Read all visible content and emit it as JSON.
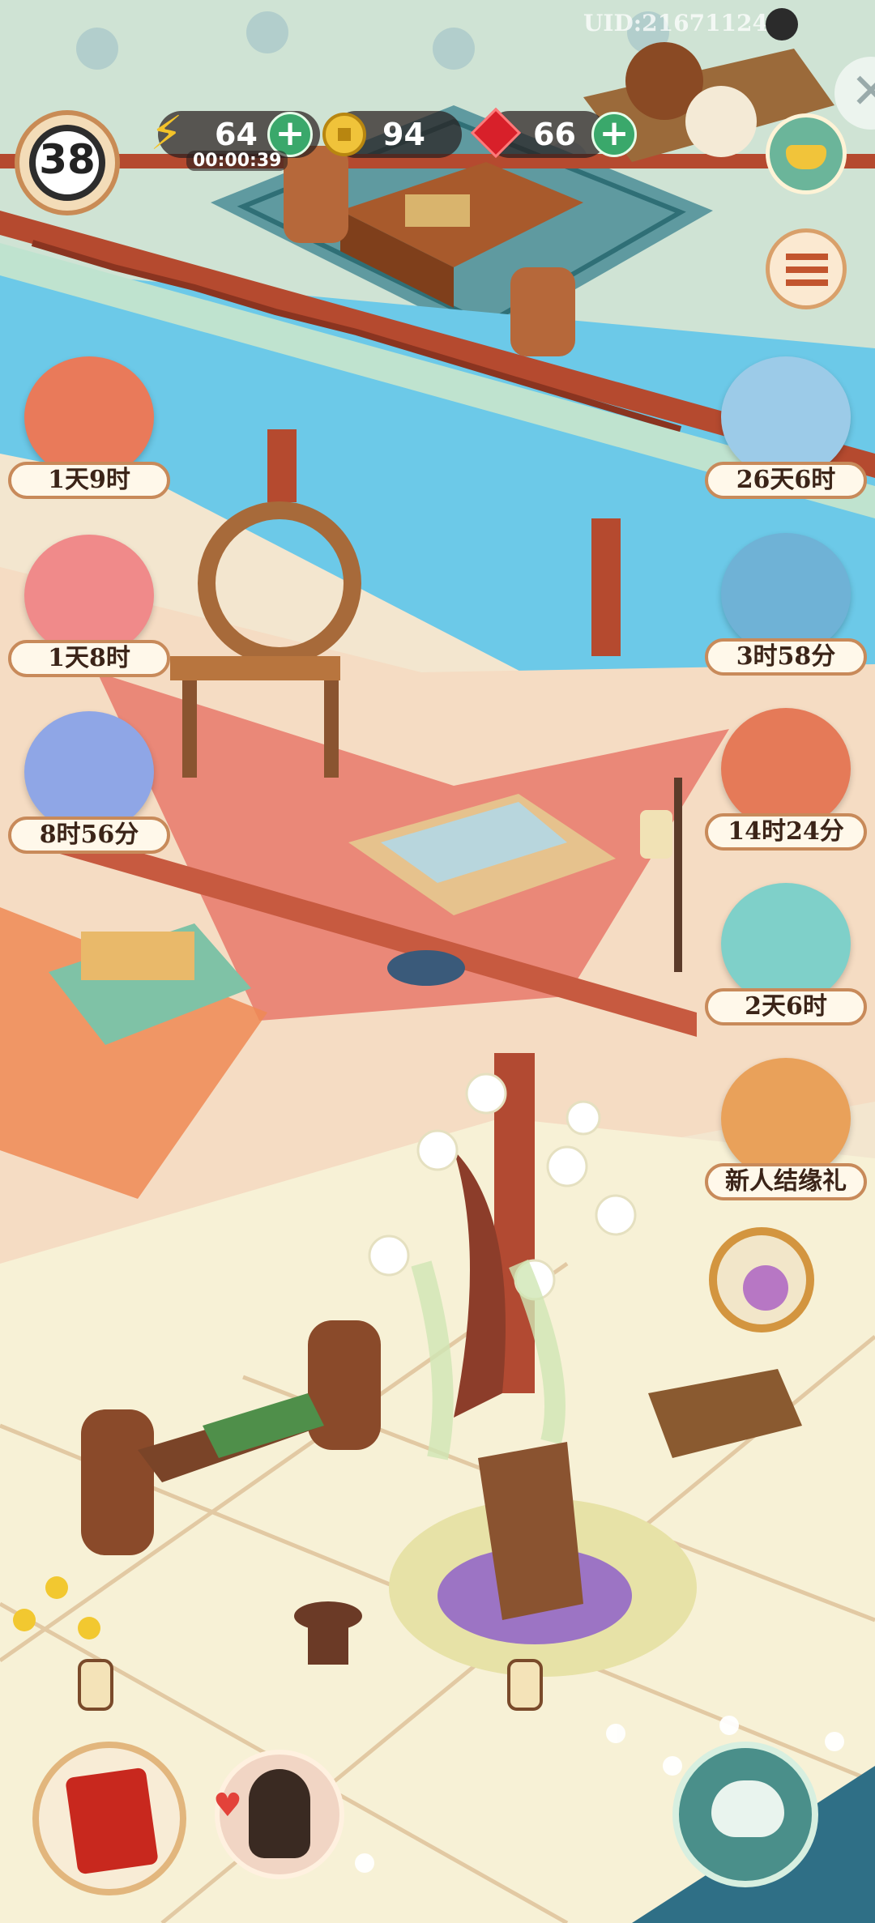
{
  "uid_text": "UID:21671124",
  "player": {
    "level": "38"
  },
  "resources": {
    "energy": {
      "value": "64",
      "timer": "00:00:39",
      "icon": "lightning-icon"
    },
    "coins": {
      "value": "94",
      "icon": "coin-icon"
    },
    "gems": {
      "value": "66",
      "icon": "red-gem-icon"
    }
  },
  "events_left": [
    {
      "label": "1天9时",
      "icon": "scroll-letters-icon"
    },
    {
      "label": "1天8时",
      "icon": "cat-drum-icon"
    },
    {
      "label": "8时56分",
      "icon": "cat-kite-icon"
    }
  ],
  "events_right": [
    {
      "label": "26天6时",
      "icon": "cat-cloud-icon"
    },
    {
      "label": "3时58分",
      "icon": "blue-box-icon"
    },
    {
      "label": "14时24分",
      "icon": "cards-icon"
    },
    {
      "label": "2天6时",
      "icon": "gift-box-cat-icon"
    },
    {
      "label": "新人结缘礼",
      "icon": "treasure-chest-icon"
    }
  ],
  "colors": {
    "water": "#6cc9e8",
    "railing": "#b54a2f",
    "floor_top": "#cfe3d4",
    "floor_mid": "#f5dcc3",
    "floor_bottom": "#f7f1d6",
    "accent_green": "#3aa86b"
  }
}
